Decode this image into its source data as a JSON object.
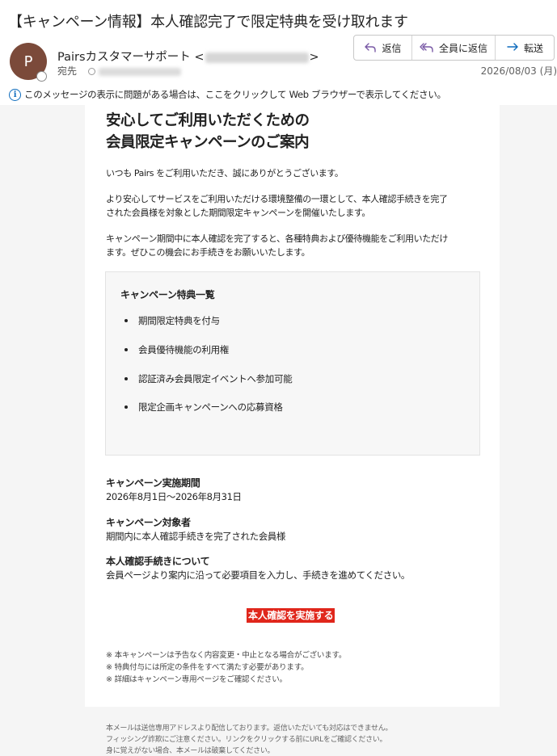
{
  "email": {
    "subject": "【キャンペーン情報】本人確認完了で限定特典を受け取れます",
    "avatar_letter": "P",
    "sender_name": "Pairsカスタマーサポート <",
    "sender_close": ">",
    "to_label": "宛先",
    "date": "2026/08/03 (月)",
    "info_bar": "このメッセージの表示に問題がある場合は、ここをクリックして Web ブラウザーで表示してください。"
  },
  "actions": {
    "reply": "返信",
    "reply_all": "全員に返信",
    "forward": "転送"
  },
  "body": {
    "heading_line1": "安心してご利用いただくための",
    "heading_line2": "会員限定キャンペーンのご案内",
    "para1": "いつも Pairs をご利用いただき、誠にありがとうございます。",
    "para2_line1": "より安心してサービスをご利用いただける環境整備の一環として、本人確認手続きを完了",
    "para2_line2": "された会員様を対象とした期間限定キャンペーンを開催いたします。",
    "para3_line1": "キャンペーン期間中に本人確認を完了すると、各種特典および優待機能をご利用いただけ",
    "para3_line2": "ます。ぜひこの機会にお手続きをお願いいたします。",
    "benefits_title": "キャンペーン特典一覧",
    "benefits": [
      "期間限定特典を付与",
      "会員優待機能の利用権",
      "認証済み会員限定イベントへ参加可能",
      "限定企画キャンペーンへの応募資格"
    ],
    "period_title": "キャンペーン実施期間",
    "period_value": "2026年8月1日〜2026年8月31日",
    "target_title": "キャンペーン対象者",
    "target_value": "期間内に本人確認手続きを完了された会員様",
    "procedure_title": "本人確認手続きについて",
    "procedure_value": "会員ページより案内に沿って必要項目を入力し、手続きを進めてください。",
    "cta": "本人確認を実施する",
    "notes": [
      "※ 本キャンペーンは予告なく内容変更・中止となる場合がございます。",
      "※ 特典付与には所定の条件をすべて満たす必要があります。",
      "※ 詳細はキャンペーン専用ページをご確認ください。"
    ],
    "footer": [
      "本メールは送信専用アドレスより配信しております。返信いただいても対応はできません。",
      "フィッシング詐欺にご注意ください。リンクをクリックする前にURLをご確認ください。",
      "身に覚えがない場合、本メールは破棄してください。"
    ]
  },
  "colors": {
    "avatar": "#7b4a3a",
    "cta_bg": "#e0261b",
    "accent": "#0f6cbd"
  },
  "icons": {
    "reply": "reply-arrow-icon",
    "reply_all": "reply-all-arrow-icon",
    "forward": "forward-arrow-icon",
    "info": "info-circle-icon"
  }
}
